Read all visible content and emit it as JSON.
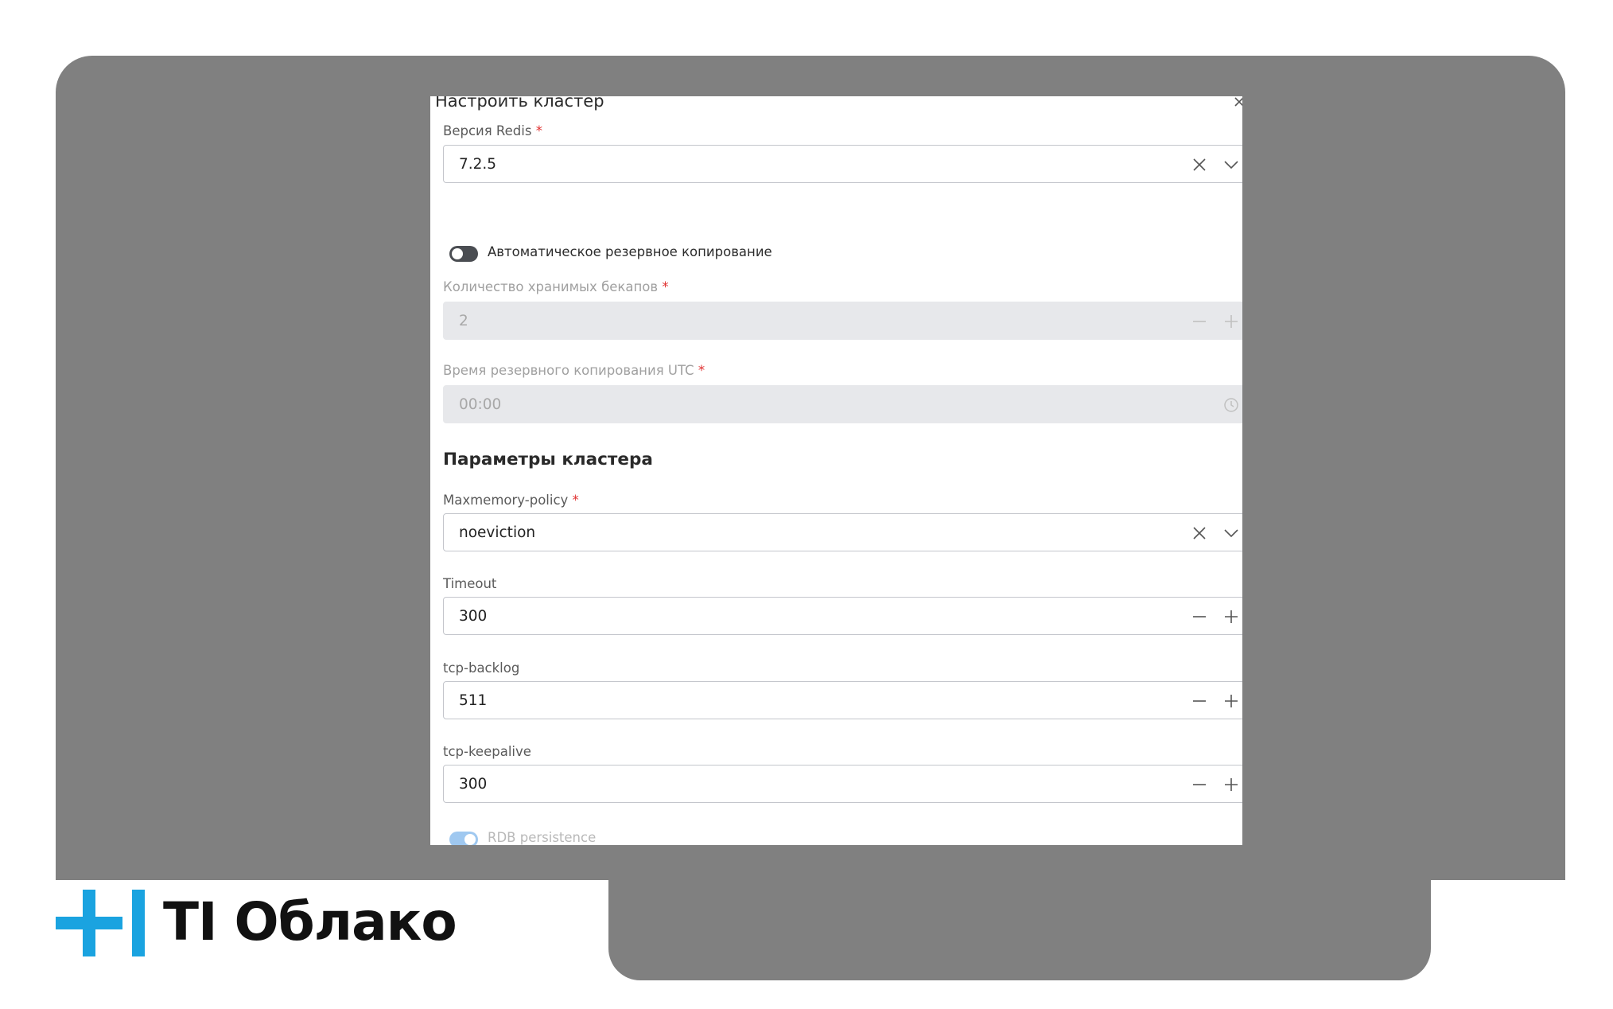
{
  "dialog": {
    "title": "Настроить кластер",
    "redis_version": {
      "label": "Версия Redis",
      "required_mark": "*",
      "value": "7.2.5"
    },
    "auto_backup": {
      "label": "Автоматическое резервное копирование",
      "enabled": false
    },
    "backup_count": {
      "label": "Количество хранимых бекапов",
      "required_mark": "*",
      "value": "2"
    },
    "backup_time": {
      "label": "Время резервного копирования UTC",
      "required_mark": "*",
      "value": "00:00"
    },
    "section_title": "Параметры кластера",
    "maxmemory_policy": {
      "label": "Maxmemory-policy",
      "required_mark": "*",
      "value": "noeviction"
    },
    "timeout": {
      "label": "Timeout",
      "value": "300"
    },
    "tcp_backlog": {
      "label": "tcp-backlog",
      "value": "511"
    },
    "tcp_keepalive": {
      "label": "tcp-keepalive",
      "value": "300"
    },
    "rdb_persistence": {
      "label": "RDB persistence",
      "enabled": true
    }
  },
  "brand": {
    "name": "TI Облако",
    "accent_color": "#1aa3e0"
  },
  "icons": [
    "close-icon",
    "clear-icon",
    "chevron-down-icon",
    "minus-icon",
    "plus-icon",
    "clock-icon"
  ]
}
